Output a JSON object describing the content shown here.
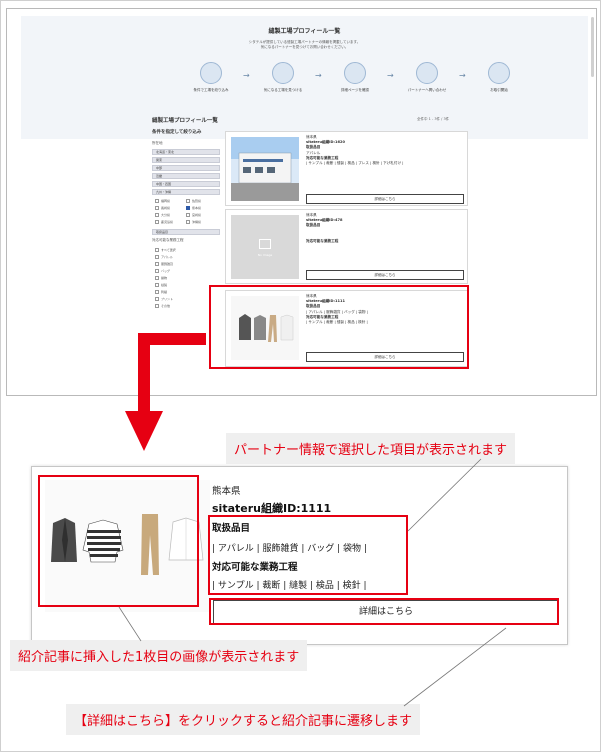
{
  "screenshot": {
    "hero": {
      "title": "縫製工場プロフィール一覧",
      "description_line1": "シタテルが提供している縫製工場パートナーの情報を掲載しています。",
      "description_line2": "気になるパートナーを見つけてお問い合わせください。",
      "steps": [
        "条件で工場を絞り込み",
        "気になる工場を見つける",
        "詳細ページを確認",
        "パートナーへ問い合わせ",
        "お取引開始"
      ]
    },
    "list_title": "縫製工場プロフィール一覧",
    "list_count": "全件中 1 - 3件 / 3件",
    "sidebar": {
      "title": "条件を指定して絞り込み",
      "section_label": "所在地",
      "filters": [
        "北海道・東北",
        "関東",
        "中部",
        "近畿",
        "中国・四国",
        "九州・沖縄"
      ],
      "prefectures": [
        {
          "label": "福岡県",
          "checked": false
        },
        {
          "label": "佐賀県",
          "checked": false
        },
        {
          "label": "長崎県",
          "checked": false
        },
        {
          "label": "熊本県",
          "checked": true
        },
        {
          "label": "大分県",
          "checked": false
        },
        {
          "label": "宮崎県",
          "checked": false
        },
        {
          "label": "鹿児島県",
          "checked": false
        },
        {
          "label": "沖縄県",
          "checked": false
        }
      ],
      "category_filter": "取扱品目",
      "category_label": "対応可能な業務工程",
      "categories": [
        "すべて選択",
        "アパレル",
        "服飾雑貨",
        "バッグ",
        "袋物",
        "縫製",
        "刺繍",
        "プリント",
        "その他"
      ]
    },
    "cards": [
      {
        "pref": "熊本県",
        "id": "sitateru組織ID:1620",
        "h1": "取扱品目",
        "t1": "アパレル",
        "h2": "対応可能な業務工程",
        "t2": "| サンプル | 裁断 | 縫製 | 検品 | プレス | 検針 | 下げ札付け |",
        "button": "詳細はこちら"
      },
      {
        "pref": "熊本県",
        "id": "sitateru組織ID:478",
        "h1": "取扱品目",
        "t1": "",
        "h2": "対応可能な業務工程",
        "t2": "",
        "button": "詳細はこちら",
        "no_image": "No Image"
      },
      {
        "pref": "熊本県",
        "id": "sitateru組織ID:1111",
        "h1": "取扱品目",
        "t1": "| アパレル | 服飾雑貨 | バッグ | 袋物 |",
        "h2": "対応可能な業務工程",
        "t2": "| サンプル | 裁断 | 縫製 | 検品 | 検針 |",
        "button": "詳細はこちら"
      }
    ]
  },
  "enlarged": {
    "pref": "熊本県",
    "id": "sitateru組織ID:1111",
    "h1": "取扱品目",
    "t1": "| アパレル | 服飾雑貨 | バッグ | 袋物 |",
    "h2": "対応可能な業務工程",
    "t2": "| サンプル | 裁断 | 縫製 | 検品 | 検針 |",
    "button": "詳細はこちら"
  },
  "callouts": {
    "partner_info": "パートナー情報で選択した項目が表示されます",
    "first_image": "紹介記事に挿入した1枚目の画像が表示されます",
    "detail_link": "【詳細はこちら】をクリックすると紹介記事に遷移します"
  },
  "colors": {
    "accent_red": "#e60012",
    "callout_bg": "#efefef",
    "checked_blue": "#2e5aa8"
  }
}
